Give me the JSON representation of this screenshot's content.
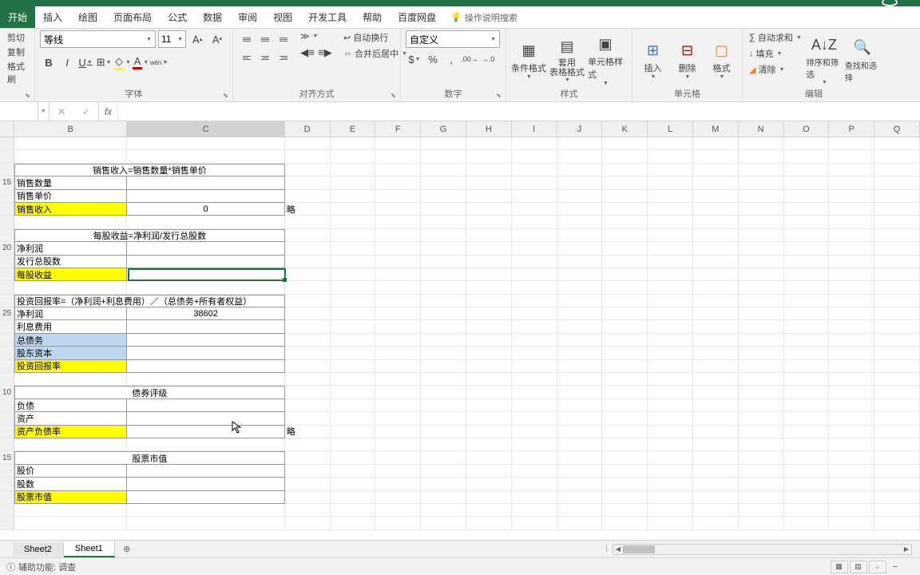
{
  "tabs": [
    "开始",
    "插入",
    "绘图",
    "页面布局",
    "公式",
    "数据",
    "审阅",
    "视图",
    "开发工具",
    "帮助",
    "百度网盘"
  ],
  "tell_me": "操作说明搜索",
  "clipboard": {
    "cut": "剪切",
    "copy": "复制",
    "format": "格式刷"
  },
  "font": {
    "name": "等线",
    "size": "11"
  },
  "wrap": "自动换行",
  "merge": "合并后居中",
  "number_format": "自定义",
  "group_labels": {
    "font": "字体",
    "align": "对齐方式",
    "number": "数字",
    "styles": "样式",
    "cells": "单元格",
    "editing": "编辑"
  },
  "styles": {
    "cond": "条件格式",
    "table": "套用\n表格格式",
    "cell": "单元格样式"
  },
  "cells": {
    "insert": "插入",
    "delete": "删除",
    "format": "格式"
  },
  "editing": {
    "sum": "自动求和",
    "fill": "填充",
    "clear": "清除",
    "sort": "排序和筛选",
    "find": "查找和选择"
  },
  "columns": [
    "B",
    "C",
    "D",
    "E",
    "F",
    "G",
    "H",
    "I",
    "J",
    "K",
    "L",
    "M",
    "N",
    "O",
    "P",
    "Q"
  ],
  "col_widths": {
    "B": 142,
    "C": 198,
    "D": 57,
    "E": 57,
    "F": 57,
    "G": 57,
    "H": 57,
    "I": 57,
    "J": 57,
    "K": 57,
    "L": 57,
    "M": 57,
    "N": 57,
    "O": 57,
    "P": 57,
    "Q": 57
  },
  "row_labels": [
    "",
    "",
    "",
    "15",
    "",
    "",
    "",
    "",
    "20",
    "",
    "",
    "",
    "",
    "25",
    "",
    "",
    "",
    "",
    "",
    "10",
    "",
    "",
    "",
    "",
    "15",
    "",
    "",
    "",
    "",
    ""
  ],
  "section1": {
    "title": "销售收入=销售数量*销售单价",
    "r1": "销售数量",
    "r2": "销售单价",
    "r3": "销售收入",
    "v3": "0",
    "note": "略"
  },
  "section2": {
    "title": "每股收益=净利润/发行总股数",
    "r1": "净利润",
    "r2": "发行总股数",
    "r3": "每股收益"
  },
  "section3": {
    "title": "投资回报率=（净利润+利息费用）／（总债务+所有者权益）",
    "r1": "净利润",
    "v1": "38602",
    "r2": "利息费用",
    "r3": "总债务",
    "r4": "股东资本",
    "r5": "投资回报率"
  },
  "section4": {
    "title": "债券评级",
    "r1": "负债",
    "r2": "资产",
    "r3": "资产负债率",
    "note": "略"
  },
  "section5": {
    "title": "股票市值",
    "r1": "股价",
    "r2": "股数",
    "r3": "股票市值"
  },
  "sheets": [
    "Sheet2",
    "Sheet1"
  ],
  "status": "辅助功能: 调查"
}
